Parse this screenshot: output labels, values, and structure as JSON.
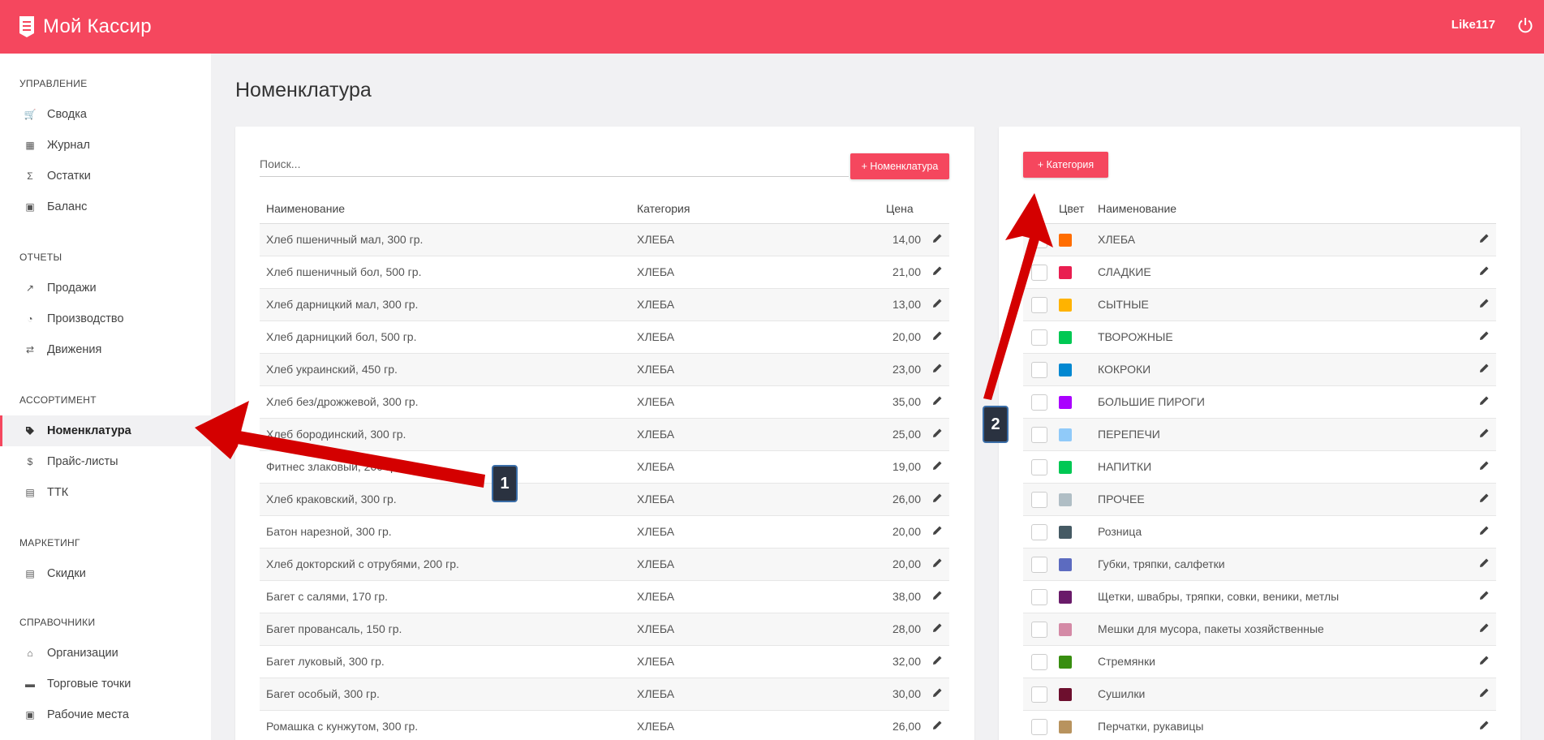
{
  "app": {
    "title": "Мой Кассир",
    "user": "Like117"
  },
  "sidebar": {
    "sections": [
      {
        "title": "УПРАВЛЕНИЕ",
        "items": [
          {
            "label": "Сводка",
            "icon": "cart-icon"
          },
          {
            "label": "Журнал",
            "icon": "calendar-icon"
          },
          {
            "label": "Остатки",
            "icon": "sigma-icon"
          },
          {
            "label": "Баланс",
            "icon": "wallet-icon"
          }
        ]
      },
      {
        "title": "ОТЧЕТЫ",
        "items": [
          {
            "label": "Продажи",
            "icon": "trending-up-icon"
          },
          {
            "label": "Производство",
            "icon": "timer-icon"
          },
          {
            "label": "Движения",
            "icon": "swap-icon"
          }
        ]
      },
      {
        "title": "АССОРТИМЕНТ",
        "items": [
          {
            "label": "Номенклатура",
            "icon": "tag-icon",
            "active": true
          },
          {
            "label": "Прайс-листы",
            "icon": "dollar-icon"
          },
          {
            "label": "ТТК",
            "icon": "clipboard-icon"
          }
        ]
      },
      {
        "title": "МАРКЕТИНГ",
        "items": [
          {
            "label": "Скидки",
            "icon": "list-icon"
          }
        ]
      },
      {
        "title": "СПРАВОЧНИКИ",
        "items": [
          {
            "label": "Организации",
            "icon": "bank-icon"
          },
          {
            "label": "Торговые точки",
            "icon": "store-icon"
          },
          {
            "label": "Рабочие места",
            "icon": "badge-icon"
          }
        ]
      }
    ]
  },
  "page": {
    "title": "Номенклатура"
  },
  "products": {
    "search_placeholder": "Поиск...",
    "add_button": "+ Номенклатура",
    "columns": {
      "name": "Наименование",
      "category": "Категория",
      "price": "Цена"
    },
    "rows": [
      {
        "name": "Хлеб пшеничный мал, 300 гр.",
        "category": "ХЛЕБА",
        "price": "14,00"
      },
      {
        "name": "Хлеб пшеничный бол, 500 гр.",
        "category": "ХЛЕБА",
        "price": "21,00"
      },
      {
        "name": "Хлеб дарницкий мал, 300 гр.",
        "category": "ХЛЕБА",
        "price": "13,00"
      },
      {
        "name": "Хлеб дарницкий бол, 500 гр.",
        "category": "ХЛЕБА",
        "price": "20,00"
      },
      {
        "name": "Хлеб украинский, 450 гр.",
        "category": "ХЛЕБА",
        "price": "23,00"
      },
      {
        "name": "Хлеб без/дрожжевой, 300 гр.",
        "category": "ХЛЕБА",
        "price": "35,00"
      },
      {
        "name": "Хлеб бородинский, 300 гр.",
        "category": "ХЛЕБА",
        "price": "25,00"
      },
      {
        "name": "Фитнес злаковый, 200 гр.",
        "category": "ХЛЕБА",
        "price": "19,00"
      },
      {
        "name": "Хлеб краковский, 300 гр.",
        "category": "ХЛЕБА",
        "price": "26,00"
      },
      {
        "name": "Батон нарезной, 300 гр.",
        "category": "ХЛЕБА",
        "price": "20,00"
      },
      {
        "name": "Хлеб докторский с отрубями, 200 гр.",
        "category": "ХЛЕБА",
        "price": "20,00"
      },
      {
        "name": "Багет с салями, 170 гр.",
        "category": "ХЛЕБА",
        "price": "38,00"
      },
      {
        "name": "Багет провансаль, 150 гр.",
        "category": "ХЛЕБА",
        "price": "28,00"
      },
      {
        "name": "Багет луковый, 300 гр.",
        "category": "ХЛЕБА",
        "price": "32,00"
      },
      {
        "name": "Багет особый, 300 гр.",
        "category": "ХЛЕБА",
        "price": "30,00"
      },
      {
        "name": "Ромашка с кунжутом, 300 гр.",
        "category": "ХЛЕБА",
        "price": "26,00"
      }
    ]
  },
  "categories": {
    "add_button": "+ Категория",
    "columns": {
      "color": "Цвет",
      "name": "Наименование"
    },
    "rows": [
      {
        "name": "ХЛЕБА",
        "color": "#ff6d00"
      },
      {
        "name": "СЛАДКИЕ",
        "color": "#e91e50"
      },
      {
        "name": "СЫТНЫЕ",
        "color": "#ffb300"
      },
      {
        "name": "ТВОРОЖНЫЕ",
        "color": "#00c853"
      },
      {
        "name": "КОКРОКИ",
        "color": "#0288d1"
      },
      {
        "name": "БОЛЬШИЕ ПИРОГИ",
        "color": "#aa00ff"
      },
      {
        "name": "ПЕРЕПЕЧИ",
        "color": "#90caf9"
      },
      {
        "name": "НАПИТКИ",
        "color": "#00c853"
      },
      {
        "name": "ПРОЧЕЕ",
        "color": "#b0bec5"
      },
      {
        "name": "Розница",
        "color": "#455a64"
      },
      {
        "name": "Губки, тряпки, салфетки",
        "color": "#5c6bc0"
      },
      {
        "name": "Щетки, швабры, тряпки, совки, веники, метлы",
        "color": "#6a1b6a"
      },
      {
        "name": "Мешки для мусора, пакеты хозяйственные",
        "color": "#d48aa6"
      },
      {
        "name": "Стремянки",
        "color": "#388e10"
      },
      {
        "name": "Сушилки",
        "color": "#6d0f2e"
      },
      {
        "name": "Перчатки, рукавицы",
        "color": "#b8935e"
      }
    ]
  },
  "annotations": {
    "badge1": "1",
    "badge2": "2"
  },
  "colors": {
    "brand": "#f5475e",
    "arrow": "#d40000"
  }
}
